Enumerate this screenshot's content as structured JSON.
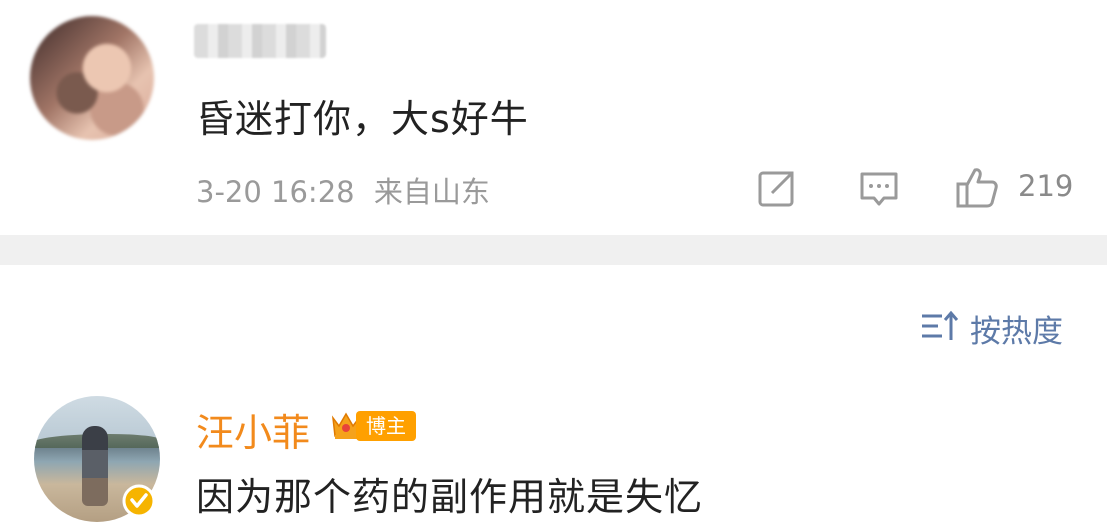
{
  "comment1": {
    "text": "昏迷打你，大s好牛",
    "time": "3-20 16:28",
    "location": "来自山东",
    "likes": "219",
    "icons": {
      "share": "share-icon",
      "comment": "comment-icon",
      "like": "thumbs-up-icon"
    }
  },
  "sort": {
    "label": "按热度",
    "icon": "sort-icon"
  },
  "comment2": {
    "username": "汪小菲",
    "badge": "博主",
    "text": "因为那个药的副作用就是失忆",
    "icons": {
      "crown": "crown-icon",
      "verified": "verified-icon"
    }
  },
  "colors": {
    "name_orange": "#f28a1c",
    "badge_orange": "#ffa000",
    "sort_blue": "#5d7aa8",
    "meta_gray": "#9a9a9a"
  }
}
